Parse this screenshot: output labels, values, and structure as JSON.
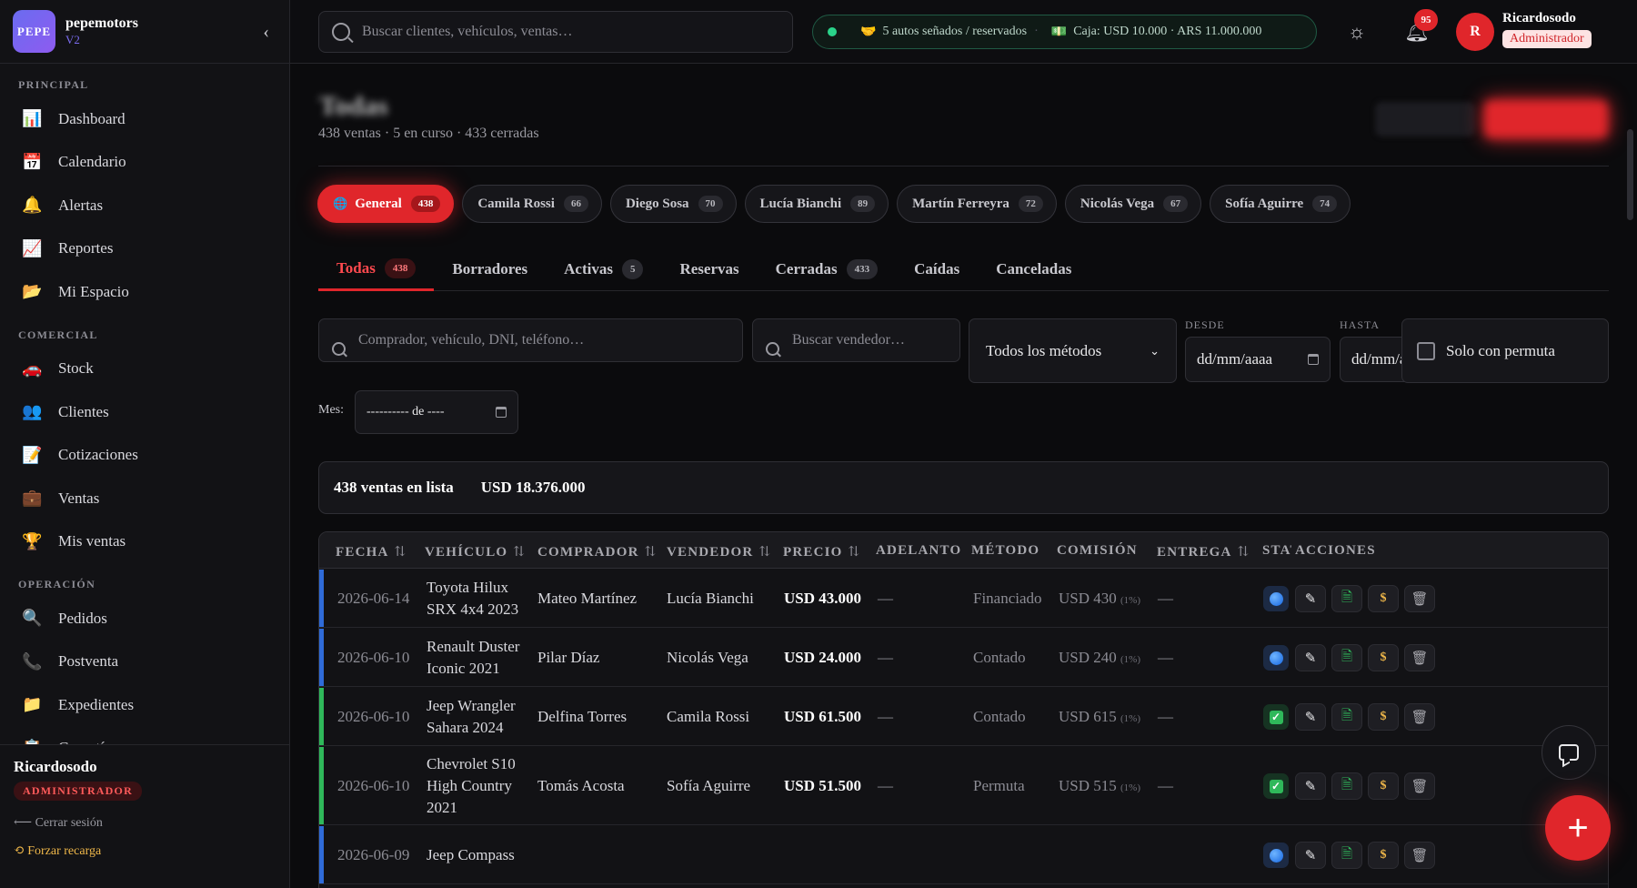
{
  "brand": {
    "logo": "PEPE",
    "name": "pepemotors",
    "version": "V2"
  },
  "sidebar": {
    "sections": [
      {
        "title": "PRINCIPAL",
        "items": [
          {
            "icon": "📊",
            "label": "Dashboard"
          },
          {
            "icon": "📅",
            "label": "Calendario"
          },
          {
            "icon": "🔔",
            "label": "Alertas"
          },
          {
            "icon": "📈",
            "label": "Reportes"
          },
          {
            "icon": "📂",
            "label": "Mi Espacio"
          }
        ]
      },
      {
        "title": "COMERCIAL",
        "items": [
          {
            "icon": "🚗",
            "label": "Stock"
          },
          {
            "icon": "👥",
            "label": "Clientes"
          },
          {
            "icon": "📝",
            "label": "Cotizaciones"
          },
          {
            "icon": "💼",
            "label": "Ventas"
          },
          {
            "icon": "🏆",
            "label": "Mis ventas"
          }
        ]
      },
      {
        "title": "OPERACIÓN",
        "items": [
          {
            "icon": "🔍",
            "label": "Pedidos"
          },
          {
            "icon": "📞",
            "label": "Postventa"
          },
          {
            "icon": "📁",
            "label": "Expedientes"
          },
          {
            "icon": "📋",
            "label": "Garantías"
          }
        ]
      }
    ],
    "footer": {
      "user": "Ricardosodo",
      "role": "ADMINISTRADOR",
      "logout": "⟵ Cerrar sesión",
      "reload": "Forzar recarga"
    }
  },
  "topbar": {
    "search_placeholder": "Buscar clientes, vehículos, ventas…",
    "reserved": "5 autos señados / reservados",
    "cash": "Caja: USD 10.000 · ARS 11.000.000",
    "notifications": "95",
    "avatar_letter": "R",
    "user": "Ricardosodo",
    "role": "Administrador"
  },
  "page": {
    "title": "Todas",
    "subtitle": "438 ventas · 5 en curso · 433 cerradas"
  },
  "sellers": [
    {
      "name": "General",
      "count": "438",
      "active": true
    },
    {
      "name": "Camila Rossi",
      "count": "66"
    },
    {
      "name": "Diego Sosa",
      "count": "70"
    },
    {
      "name": "Lucía Bianchi",
      "count": "89"
    },
    {
      "name": "Martín Ferreyra",
      "count": "72"
    },
    {
      "name": "Nicolás Vega",
      "count": "67"
    },
    {
      "name": "Sofía Aguirre",
      "count": "74"
    }
  ],
  "tabs": [
    {
      "label": "Todas",
      "count": "438",
      "active": true
    },
    {
      "label": "Borradores",
      "count": ""
    },
    {
      "label": "Activas",
      "count": "5"
    },
    {
      "label": "Reservas",
      "count": ""
    },
    {
      "label": "Cerradas",
      "count": "433"
    },
    {
      "label": "Caídas",
      "count": ""
    },
    {
      "label": "Canceladas",
      "count": ""
    }
  ],
  "filters": {
    "buyer_placeholder": "Comprador, vehículo, DNI, teléfono…",
    "seller_placeholder": "Buscar vendedor…",
    "method": "Todos los métodos",
    "from_label": "DESDE",
    "to_label": "HASTA",
    "from_value": "dd/mm/aaaa",
    "to_value": "dd/mm/aaaa",
    "permuta": "Solo con permuta",
    "month_label": "Mes:",
    "month_value": "---------- de ----"
  },
  "summary": {
    "count": "438 ventas en lista",
    "total": "USD 18.376.000"
  },
  "table": {
    "headers": [
      "FECHA",
      "VEHÍCULO",
      "COMPRADOR",
      "VENDEDOR",
      "PRECIO",
      "ADELANTO",
      "MÉTODO",
      "COMISIÓN",
      "ENTREGA",
      "STATUS",
      "ACCIONES"
    ],
    "rows": [
      {
        "date": "2026-06-14",
        "vehicle": [
          "Toyota Hilux",
          "SRX 4x4 2023"
        ],
        "buyer": "Mateo Martínez",
        "seller": "Lucía Bianchi",
        "price": "USD 43.000",
        "advance": "—",
        "method": "Financiado",
        "commission": "USD 430",
        "pct": "(1%)",
        "delivery": "—",
        "status": "blue",
        "stripe": "#2f6bd8"
      },
      {
        "date": "2026-06-10",
        "vehicle": [
          "Renault Duster",
          "Iconic 2021"
        ],
        "buyer": "Pilar Díaz",
        "seller": "Nicolás Vega",
        "price": "USD 24.000",
        "advance": "—",
        "method": "Contado",
        "commission": "USD 240",
        "pct": "(1%)",
        "delivery": "—",
        "status": "blue",
        "stripe": "#2f6bd8"
      },
      {
        "date": "2026-06-10",
        "vehicle": [
          "Jeep Wrangler",
          "Sahara 2024"
        ],
        "buyer": "Delfina Torres",
        "seller": "Camila Rossi",
        "price": "USD 61.500",
        "advance": "—",
        "method": "Contado",
        "commission": "USD 615",
        "pct": "(1%)",
        "delivery": "—",
        "status": "green",
        "stripe": "#2fb85a"
      },
      {
        "date": "2026-06-10",
        "vehicle": [
          "Chevrolet S10",
          "High Country",
          "2021"
        ],
        "buyer": "Tomás Acosta",
        "seller": "Sofía Aguirre",
        "price": "USD 51.500",
        "advance": "—",
        "method": "Permuta",
        "commission": "USD 515",
        "pct": "(1%)",
        "delivery": "—",
        "status": "green",
        "stripe": "#2fb85a"
      },
      {
        "date": "2026-06-09",
        "vehicle": [
          "Jeep Compass"
        ],
        "buyer": "",
        "seller": "",
        "price": "",
        "advance": "",
        "method": "",
        "commission": "",
        "pct": "",
        "delivery": "",
        "status": "blue",
        "stripe": "#2f6bd8"
      }
    ]
  }
}
